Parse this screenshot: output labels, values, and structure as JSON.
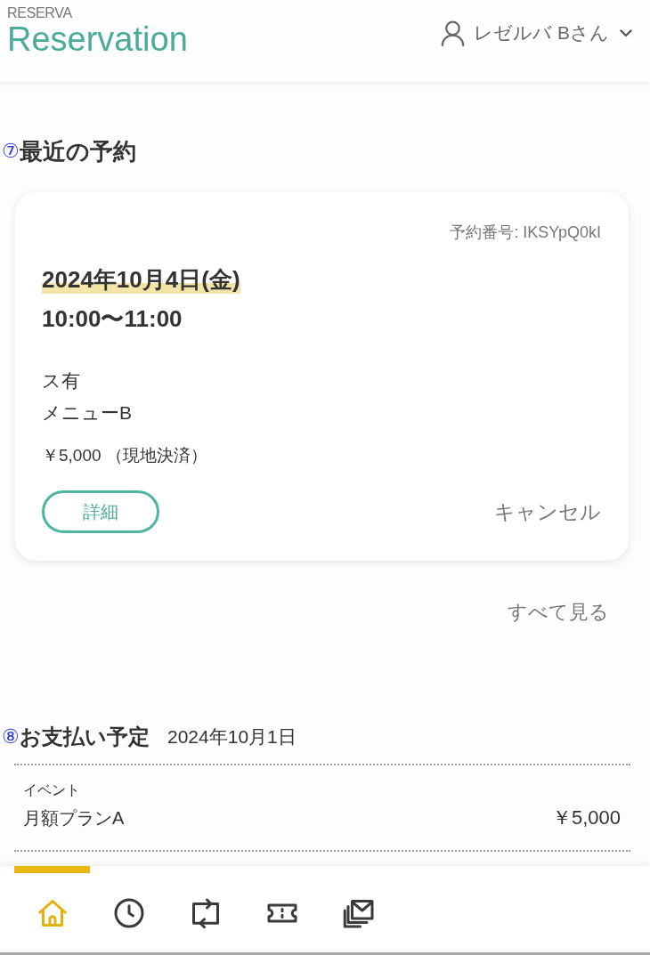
{
  "header": {
    "brand_label": "RESERVA",
    "brand_name": "Reservation",
    "user_name": "レゼルバ Bさん"
  },
  "recent": {
    "marker": "⑦",
    "title": "最近の予約",
    "card": {
      "number": "予約番号: IKSYpQ0kI",
      "date": "2024年10月4日(金)",
      "time": "10:00〜11:00",
      "details": [
        "ス有",
        "メニューB"
      ],
      "price": "￥5,000 （現地決済）",
      "detail_button": "詳細",
      "cancel_link": "キャンセル"
    },
    "see_all": "すべて見る"
  },
  "payment": {
    "marker": "⑧",
    "title": "お支払い予定",
    "date": "2024年10月1日",
    "rows": [
      {
        "type": "イベント",
        "name": "月額プランA",
        "amount": "￥5,000"
      }
    ]
  },
  "nav": [
    {
      "selected": true
    },
    {
      "selected": false
    },
    {
      "selected": false
    },
    {
      "selected": false
    },
    {
      "selected": false
    }
  ]
}
